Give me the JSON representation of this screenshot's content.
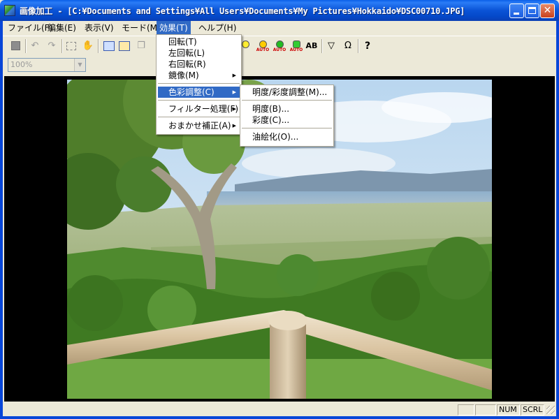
{
  "window": {
    "title": "画像加工 - [C:¥Documents and Settings¥All Users¥Documents¥My Pictures¥Hokkaido¥DSC00710.JPG]",
    "close_glyph": "✕"
  },
  "menubar": {
    "items": [
      "ファイル(F)",
      "編集(E)",
      "表示(V)",
      "モード(M)",
      "効果(T)",
      "ヘルプ(H)"
    ]
  },
  "toolbar": {
    "help_glyph": "?",
    "auto_label": "AUTO",
    "ab_label": "AB",
    "filter_glyph": "▽",
    "omega_glyph": "Ω"
  },
  "zoom": {
    "value": "100%",
    "arrow_glyph": "▼"
  },
  "effects_menu": {
    "items": [
      {
        "label": "回転(T)",
        "submenu": false
      },
      {
        "label": "左回転(L)",
        "submenu": false
      },
      {
        "label": "右回転(R)",
        "submenu": false
      },
      {
        "label": "鏡像(M)",
        "submenu": true
      },
      {
        "label": "色彩調整(C)",
        "submenu": true
      },
      {
        "label": "フィルター処理(F)",
        "submenu": true
      },
      {
        "label": "おまかせ補正(A)",
        "submenu": true
      }
    ],
    "submenu_glyph": "▶"
  },
  "color_submenu": {
    "items": [
      "明度/彩度調整(M)...",
      "明度(B)...",
      "彩度(C)...",
      "油絵化(O)..."
    ]
  },
  "statusbar": {
    "num": "NUM",
    "scrl": "SCRL"
  }
}
